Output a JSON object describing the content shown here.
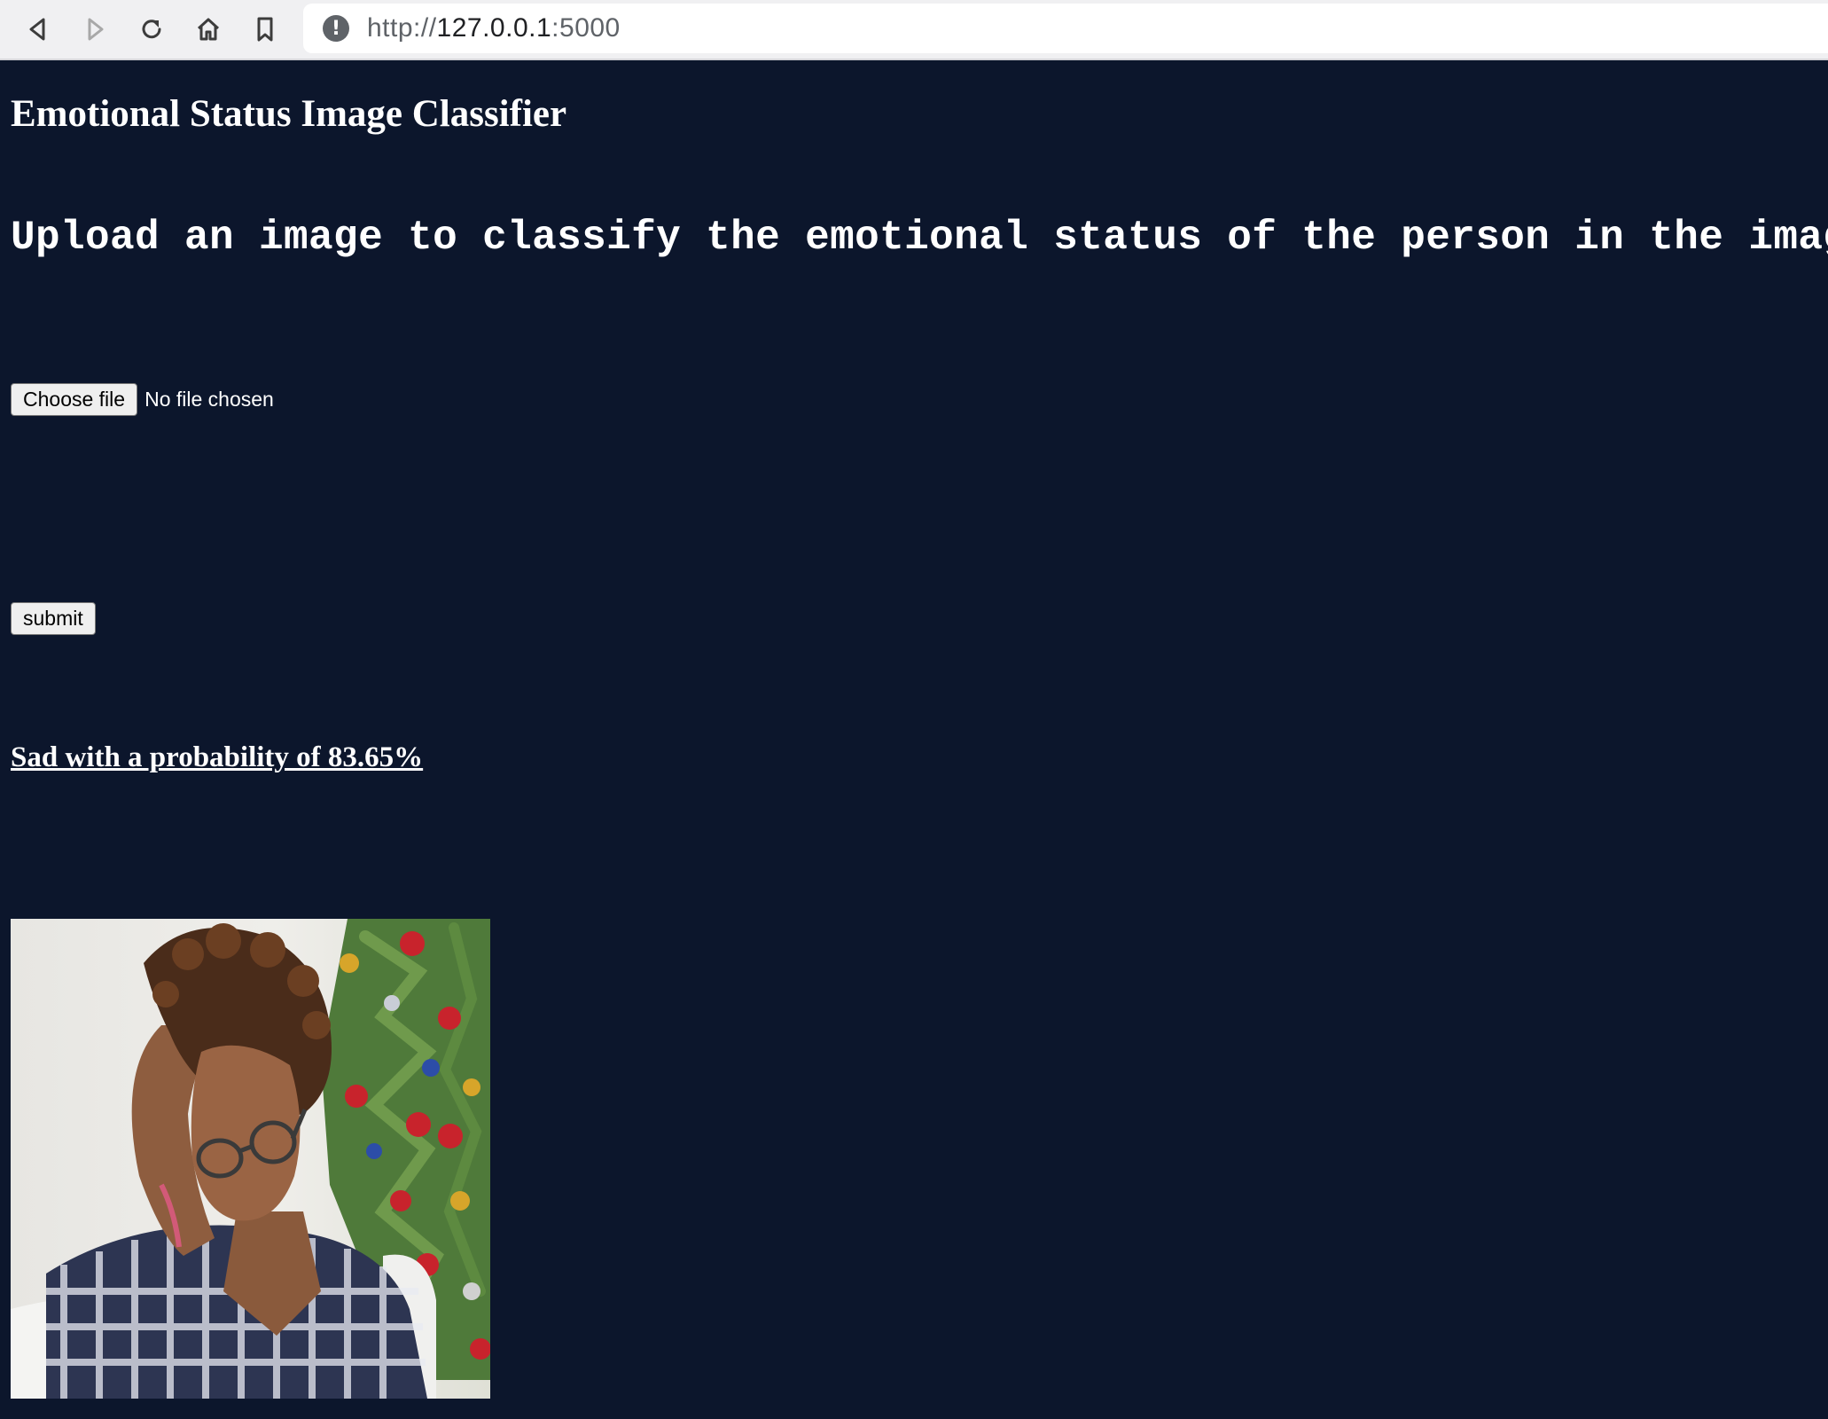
{
  "browser": {
    "url_scheme": "http://",
    "url_host": "127.0.0.1",
    "url_port": ":5000",
    "icons": {
      "back": "back-arrow-icon",
      "forward": "forward-arrow-icon",
      "reload": "reload-icon",
      "home": "home-icon",
      "bookmark": "bookmark-icon",
      "site_info": "info-icon"
    }
  },
  "page": {
    "title": "Emotional Status Image Classifier",
    "subtitle": "Upload an image to classify the emotional status of the person in the image",
    "choose_file_label": "Choose file",
    "file_status": "No file chosen",
    "submit_label": "submit",
    "result": "Sad with a probability of 83.65%"
  },
  "colors": {
    "background": "#0c162c",
    "text": "#ffffff",
    "toolbar": "#f0f0f2"
  }
}
